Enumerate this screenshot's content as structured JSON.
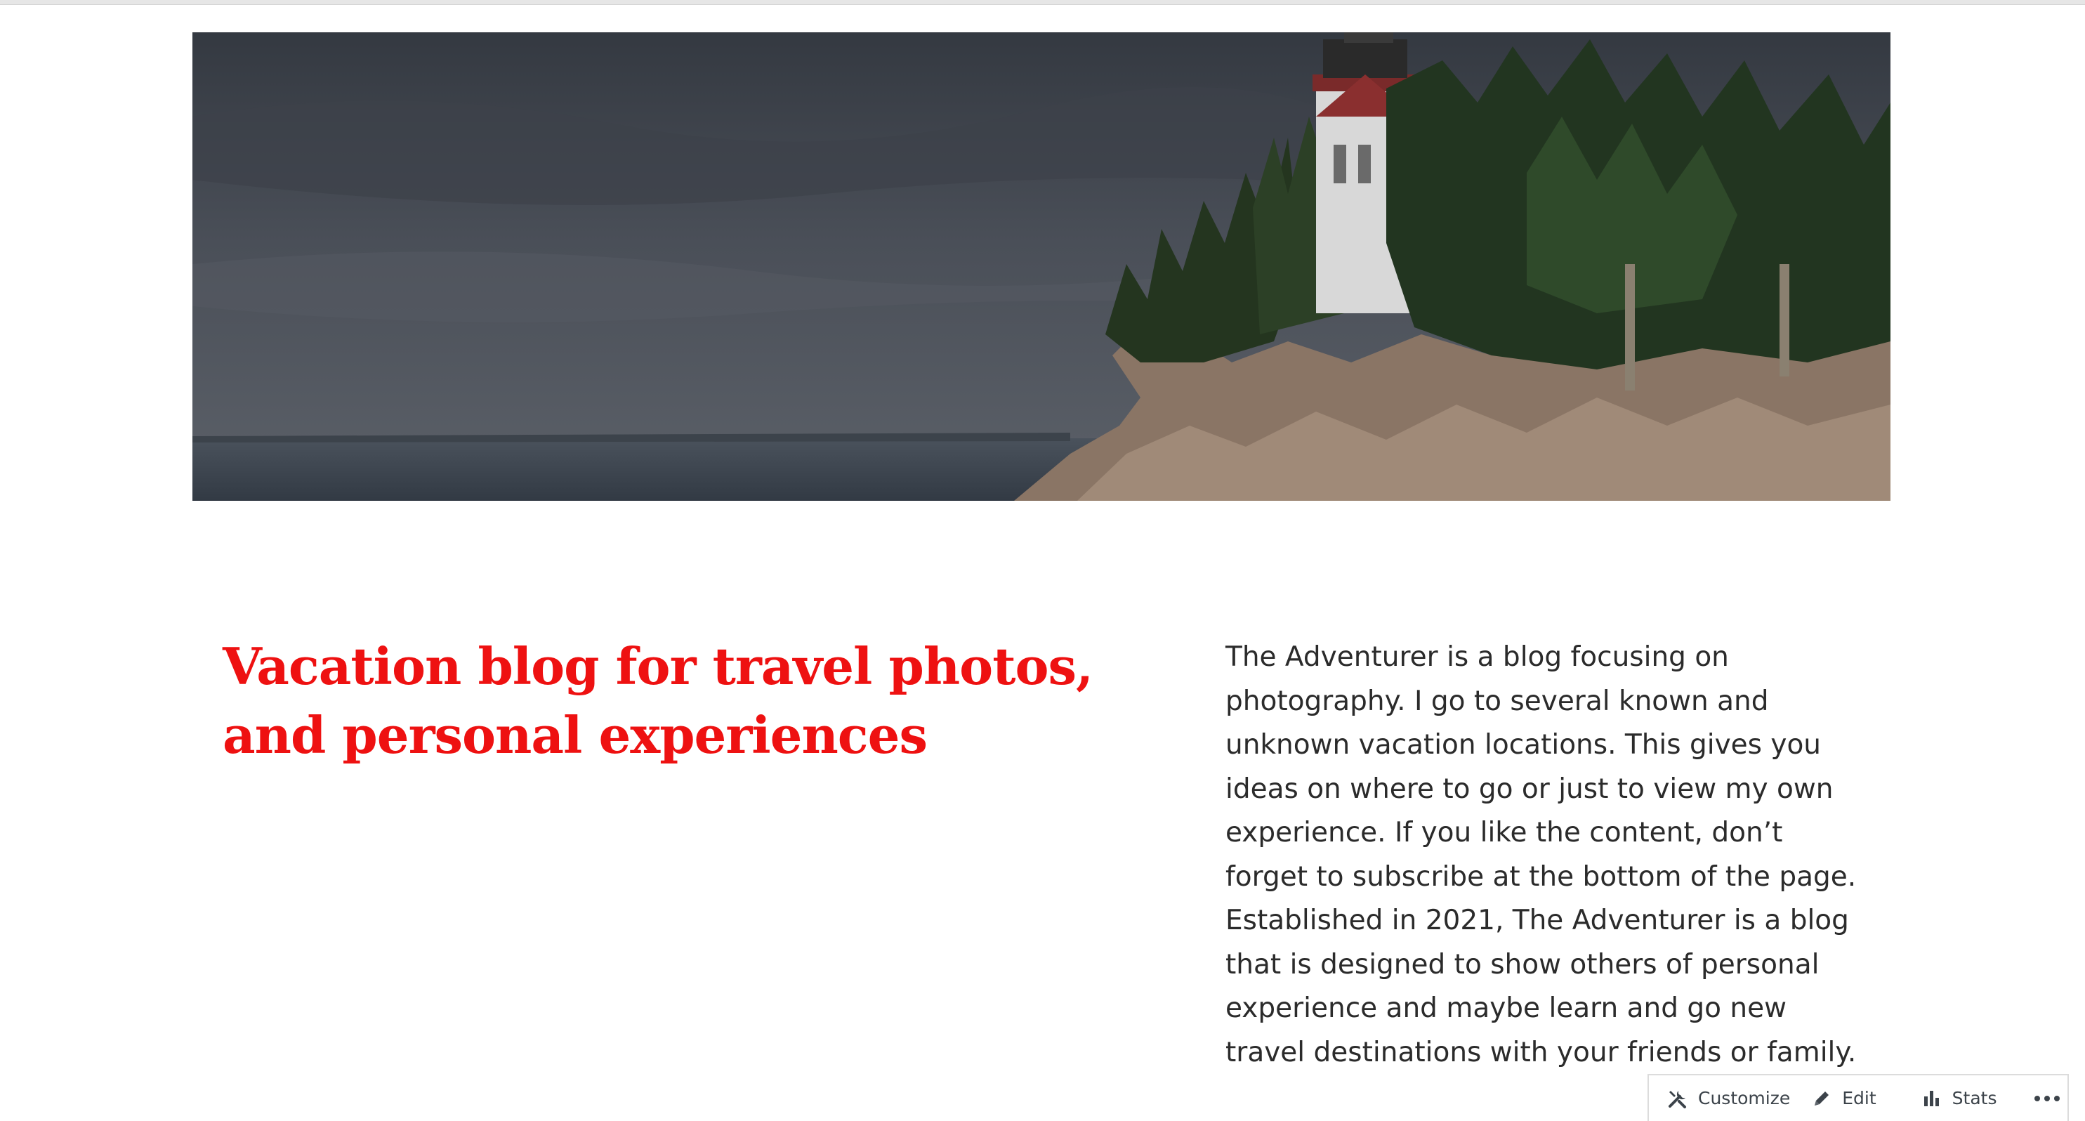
{
  "hero": {
    "image": "lighthouse-coastline-photo"
  },
  "intro": {
    "headline": "Vacation blog for travel photos, and personal experiences",
    "about": "The Adventurer is a blog focusing on photography. I go to several known and unknown vacation locations. This gives you ideas on where to go or just to view my own experience. If you like the content, don’t forget to subscribe at the bottom of the page. Established in 2021, The Adventurer is a blog that is designed to show others of personal experience and maybe learn and go new travel destinations with your friends or family."
  },
  "admin_bar": {
    "customize_label": "Customize",
    "customize_icon": "tools-icon",
    "edit_label": "Edit",
    "edit_icon": "pencil-icon",
    "stats_label": "Stats",
    "stats_icon": "bar-chart-icon",
    "more_icon": "ellipsis-icon"
  },
  "colors": {
    "headline": "#ee1111",
    "body_text": "#2b2b2b",
    "admin_text": "#3c434a"
  }
}
